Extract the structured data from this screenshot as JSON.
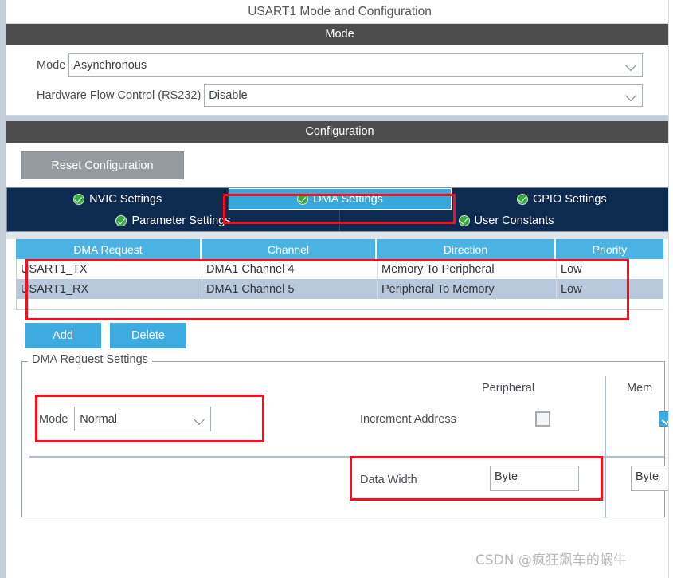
{
  "panel": {
    "title": "USART1 Mode and Configuration"
  },
  "mode_section": {
    "header": "Mode",
    "fields": [
      {
        "label": "Mode",
        "value": "Asynchronous",
        "icon": "chevron-down-icon"
      },
      {
        "label": "Hardware Flow Control (RS232)",
        "value": "Disable",
        "icon": "chevron-down-icon"
      }
    ]
  },
  "configuration": {
    "header": "Configuration",
    "reset_button": "Reset Configuration",
    "tabs_row1": [
      {
        "label": "NVIC Settings",
        "active": false,
        "icon": "green-check-icon"
      },
      {
        "label": "DMA Settings",
        "active": true,
        "icon": "green-check-icon"
      },
      {
        "label": "GPIO Settings",
        "active": false,
        "icon": "green-check-icon"
      }
    ],
    "tabs_row2": [
      {
        "label": "Parameter Settings",
        "active": false,
        "icon": "green-check-icon"
      },
      {
        "label": "User Constants",
        "active": false,
        "icon": "green-check-icon"
      }
    ]
  },
  "dma_table": {
    "columns": [
      "DMA Request",
      "Channel",
      "Direction",
      "Priority"
    ],
    "rows": [
      {
        "request": "USART1_TX",
        "channel": "DMA1 Channel 4",
        "direction": "Memory To Peripheral",
        "priority": "Low",
        "selected": false
      },
      {
        "request": "USART1_RX",
        "channel": "DMA1 Channel 5",
        "direction": "Peripheral To Memory",
        "priority": "Low",
        "selected": true
      }
    ]
  },
  "actions": {
    "add_label": "Add",
    "delete_label": "Delete"
  },
  "request_settings": {
    "legend": "DMA Request Settings",
    "column_headers": {
      "peripheral": "Peripheral",
      "memory": "Mem"
    },
    "mode": {
      "label": "Mode",
      "value": "Normal",
      "icon": "chevron-down-icon"
    },
    "increment_address": {
      "label": "Increment Address",
      "peripheral_checked": false,
      "memory_checked": true
    },
    "data_width": {
      "label": "Data Width",
      "peripheral_value": "Byte",
      "memory_value": "Byte"
    }
  },
  "watermark": {
    "text": "CSDN @疯狂飙车的蜗牛"
  },
  "colors": {
    "accent_blue": "#3dabe0",
    "tab_bar_navy": "#0d2a50",
    "section_bar_gray": "#4d4d4d",
    "highlight_red": "#fc0d1b",
    "table_header_blue": "#4bb3e4",
    "selected_row": "#b8c9dd",
    "check_green": "#36a93f"
  }
}
